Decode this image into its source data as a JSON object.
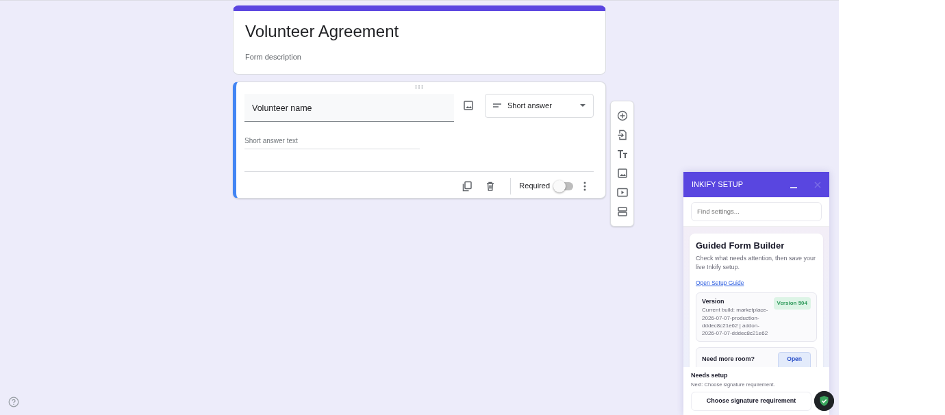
{
  "form": {
    "title": "Volunteer Agreement",
    "description": "Form description"
  },
  "question": {
    "title": "Volunteer name",
    "type": "Short answer",
    "answer_placeholder": "Short answer text",
    "required_label": "Required",
    "required": false
  },
  "panel": {
    "title": "INKIFY SETUP",
    "search": {
      "placeholder": "Find settings..."
    },
    "guide": {
      "title": "Guided Form Builder",
      "text": "Check what needs attention, then save your live Inkify setup.",
      "link": "Open Setup Guide"
    },
    "version": {
      "label": "Version",
      "badge": "Version 504",
      "detail": "Current build: marketplace-2026-07-07-production-dddec8c21e62 | addon-2026-07-07-dddec8c21e62"
    },
    "room": {
      "title": "Need more room?",
      "button": "Open"
    },
    "status": {
      "title": "Needs setup",
      "next": "Next: Choose signature requirement.",
      "button": "Choose signature requirement"
    }
  }
}
